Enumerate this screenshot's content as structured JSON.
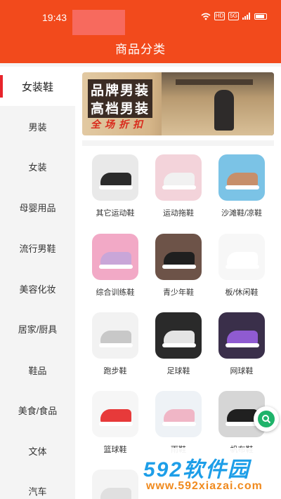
{
  "status_bar": {
    "time": "19:43",
    "badges": [
      "HD",
      "5G"
    ]
  },
  "header": {
    "title": "商品分类"
  },
  "sidebar": {
    "items": [
      {
        "label": "女装鞋",
        "active": true
      },
      {
        "label": "男装"
      },
      {
        "label": "女装"
      },
      {
        "label": "母婴用品"
      },
      {
        "label": "流行男鞋"
      },
      {
        "label": "美容化妆"
      },
      {
        "label": "居家/厨具"
      },
      {
        "label": "鞋品"
      },
      {
        "label": "美食/食品"
      },
      {
        "label": "文体"
      },
      {
        "label": "汽车"
      }
    ]
  },
  "banner": {
    "line1": "品牌男装",
    "line2": "高档男装",
    "line3": "全场折扣"
  },
  "products": [
    {
      "name": "其它运动鞋",
      "bg": "#e9e9e9",
      "shoe": "#2b2b2b"
    },
    {
      "name": "运动拖鞋",
      "bg": "#f3d3da",
      "shoe": "#f1f1f1"
    },
    {
      "name": "沙滩鞋/凉鞋",
      "bg": "#7bc3e6",
      "shoe": "#c68f6b"
    },
    {
      "name": "综合训练鞋",
      "bg": "#f2a9c6",
      "shoe": "#c9a6d8"
    },
    {
      "name": "青少年鞋",
      "bg": "#6d5348",
      "shoe": "#1f1f1f"
    },
    {
      "name": "板/休闲鞋",
      "bg": "#f7f7f7",
      "shoe": "#ffffff"
    },
    {
      "name": "跑步鞋",
      "bg": "#f2f2f2",
      "shoe": "#c8c8c8"
    },
    {
      "name": "足球鞋",
      "bg": "#2a2a2a",
      "shoe": "#e4e4e4"
    },
    {
      "name": "网球鞋",
      "bg": "#3a2f4a",
      "shoe": "#8f5bd1"
    },
    {
      "name": "篮球鞋",
      "bg": "#f6f6f6",
      "shoe": "#e73a3a"
    },
    {
      "name": "雨鞋",
      "bg": "#eef2f6",
      "shoe": "#f0b6c6"
    },
    {
      "name": "帆布鞋",
      "bg": "#d6d6d6",
      "shoe": "#202020"
    },
    {
      "name": "",
      "bg": "#f4f4f4",
      "shoe": "#e0e0e0"
    }
  ],
  "watermark": {
    "main": "592软件园",
    "url": "www.592xiazai.com"
  },
  "colors": {
    "header": "#f24a1c",
    "accent": "#e8242b",
    "fab": "#1fb36a"
  },
  "icons": [
    "wifi-icon",
    "signal-icon",
    "battery-icon",
    "search-fab-icon"
  ]
}
